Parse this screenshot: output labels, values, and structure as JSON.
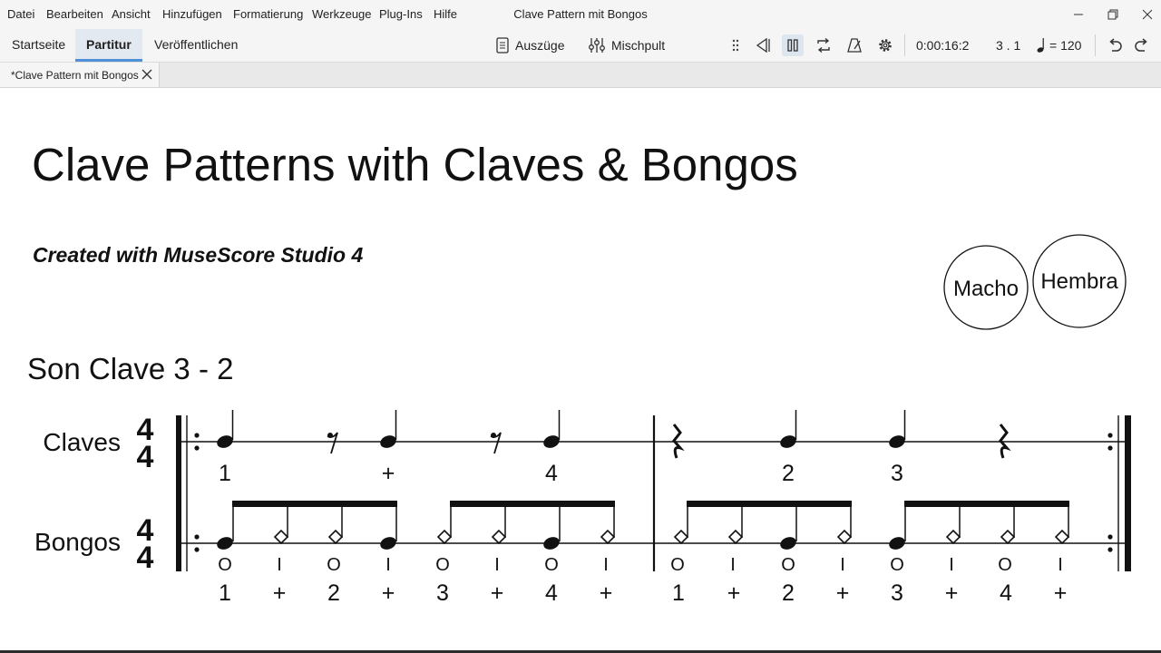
{
  "menu": [
    "Datei",
    "Bearbeiten",
    "Ansicht",
    "Hinzufügen",
    "Formatierung",
    "Werkzeuge",
    "Plug-Ins",
    "Hilfe"
  ],
  "window_title": "Clave Pattern mit Bongos",
  "top_tabs": [
    "Startseite",
    "Partitur",
    "Veröffentlichen"
  ],
  "toolbar": {
    "parts_label": "Auszüge",
    "mixer_label": "Mischpult",
    "time": "0:00:16:2",
    "position": "3 . 1",
    "tempo": "= 120"
  },
  "doc_tab": "*Clave Pattern mit Bongos",
  "score": {
    "title": "Clave Patterns with Claves & Bongos",
    "subtitle": "Created with MuseScore Studio 4",
    "drum_labels": [
      "Macho",
      "Hembra"
    ],
    "section_label": "Son Clave 3 - 2",
    "instruments": [
      "Claves",
      "Bongos"
    ],
    "time_signature": [
      "4",
      "4"
    ],
    "claves_counts": [
      "1",
      "+",
      "4",
      "2",
      "3"
    ],
    "bongos_strokes": [
      "O",
      "I",
      "O",
      "I",
      "O",
      "I",
      "O",
      "I",
      "O",
      "I",
      "O",
      "I",
      "O",
      "I",
      "O",
      "I"
    ],
    "bongos_counts": [
      "1",
      "+",
      "2",
      "+",
      "3",
      "+",
      "4",
      "+",
      "1",
      "+",
      "2",
      "+",
      "3",
      "+",
      "4",
      "+"
    ]
  }
}
